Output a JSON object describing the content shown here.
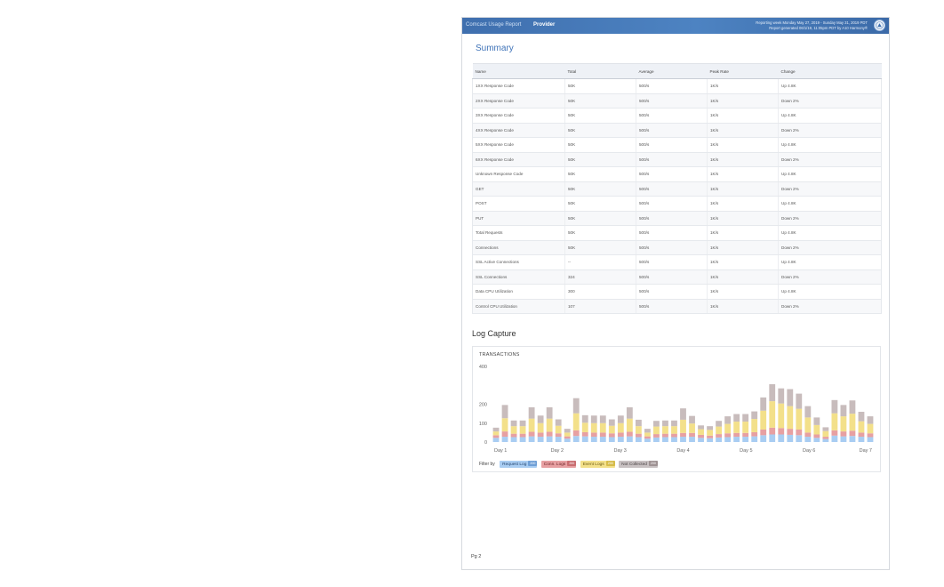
{
  "header": {
    "title": "Comcast Usage Report",
    "provider": "Provider",
    "reporting_line": "Reporting week Monday May 27, 2019 - Sunday May 31, 2019 PDT",
    "generated_line": "Report generated 06/1/19, 11:05pm PDT by A10 Harmony®",
    "logo_icon": "a10-logo-icon"
  },
  "summary": {
    "title": "Summary",
    "columns": [
      "Name",
      "Total",
      "Average",
      "Peak Rate",
      "Change"
    ],
    "rows": [
      [
        "1XX Response Code",
        "50K",
        "500/s",
        "1K/s",
        "Up 4.8K"
      ],
      [
        "2XX Response Code",
        "50K",
        "500/s",
        "1K/s",
        "Down 2%"
      ],
      [
        "3XX Response Code",
        "50K",
        "500/s",
        "1K/s",
        "Up 4.8K"
      ],
      [
        "4XX Response Code",
        "50K",
        "500/s",
        "1K/s",
        "Down 2%"
      ],
      [
        "5XX Response Code",
        "50K",
        "500/s",
        "1K/s",
        "Up 4.8K"
      ],
      [
        "6XX Response Code",
        "50K",
        "500/s",
        "1K/s",
        "Down 2%"
      ],
      [
        "Unknown Response Code",
        "50K",
        "500/s",
        "1K/s",
        "Up 4.8K"
      ],
      [
        "GET",
        "50K",
        "500/s",
        "1K/s",
        "Down 2%"
      ],
      [
        "POST",
        "50K",
        "500/s",
        "1K/s",
        "Up 4.8K"
      ],
      [
        "PUT",
        "50K",
        "500/s",
        "1K/s",
        "Down 2%"
      ],
      [
        "Total Requests",
        "50K",
        "500/s",
        "1K/s",
        "Up 4.8K"
      ],
      [
        "Connections",
        "50K",
        "500/s",
        "1K/s",
        "Down 2%"
      ],
      [
        "SSL Active Connections",
        "--",
        "500/s",
        "1K/s",
        "Up 4.8K"
      ],
      [
        "SSL Connections",
        "324",
        "500/s",
        "1K/s",
        "Down 2%"
      ],
      [
        "Data CPU Utilization",
        "300",
        "500/s",
        "1K/s",
        "Up 4.8K"
      ],
      [
        "Control CPU Utilization",
        "107",
        "500/s",
        "1K/s",
        "Down 2%"
      ]
    ]
  },
  "log_capture": {
    "title": "Log Capture",
    "chart_label": "TRANSACTIONS",
    "filter_label": "Filter by",
    "filters": [
      {
        "label": "Request Log",
        "count": "200"
      },
      {
        "label": "Conn. Logs",
        "count": "200"
      },
      {
        "label": "Event Logs",
        "count": "200"
      },
      {
        "label": "Not Collected",
        "count": "200"
      }
    ]
  },
  "chart_data": {
    "type": "bar",
    "stacked": true,
    "ylim": [
      0,
      400
    ],
    "yticks": [
      0,
      100,
      200,
      400
    ],
    "x_tick_labels": [
      "Day 1",
      "Day 2",
      "Day 3",
      "Day 4",
      "Day 5",
      "Day 6",
      "Day 7"
    ],
    "colors": {
      "request": "#a9cdf2",
      "conn": "#e7a0a2",
      "event": "#f3e08a",
      "not_collected": "#c8bcbc"
    },
    "series": [
      {
        "name": "Request Log",
        "values": [
          22,
          28,
          26,
          26,
          30,
          28,
          30,
          28,
          18,
          32,
          30,
          28,
          28,
          26,
          28,
          30,
          26,
          18,
          24,
          26,
          26,
          28,
          28,
          22,
          20,
          24,
          26,
          28,
          28,
          30,
          36,
          40,
          40,
          38,
          36,
          28,
          22,
          16,
          34,
          30,
          32,
          28,
          26
        ]
      },
      {
        "name": "Conn. Logs",
        "values": [
          14,
          28,
          18,
          18,
          24,
          22,
          24,
          18,
          12,
          30,
          22,
          22,
          22,
          20,
          22,
          24,
          18,
          12,
          18,
          18,
          18,
          20,
          20,
          16,
          14,
          18,
          20,
          20,
          20,
          22,
          30,
          36,
          34,
          32,
          30,
          22,
          18,
          12,
          28,
          26,
          28,
          22,
          20
        ]
      },
      {
        "name": "Event Logs",
        "values": [
          20,
          70,
          40,
          40,
          70,
          50,
          70,
          40,
          20,
          90,
          50,
          50,
          50,
          40,
          50,
          70,
          40,
          20,
          40,
          40,
          40,
          70,
          50,
          30,
          30,
          40,
          50,
          60,
          60,
          70,
          100,
          140,
          130,
          120,
          110,
          80,
          50,
          30,
          90,
          80,
          90,
          60,
          50
        ]
      },
      {
        "name": "Not Collected",
        "values": [
          20,
          70,
          30,
          30,
          60,
          40,
          60,
          34,
          20,
          80,
          40,
          40,
          40,
          34,
          40,
          60,
          34,
          20,
          30,
          30,
          30,
          60,
          40,
          20,
          20,
          30,
          40,
          40,
          40,
          40,
          70,
          90,
          80,
          90,
          80,
          60,
          40,
          20,
          70,
          60,
          70,
          50,
          40
        ]
      }
    ]
  },
  "footer": {
    "page": "Pg 2"
  }
}
